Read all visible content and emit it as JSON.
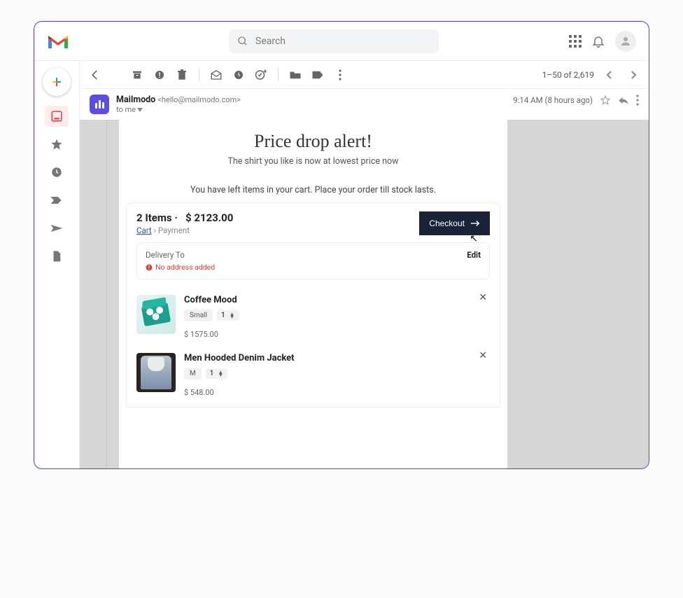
{
  "search": {
    "placeholder": "Search"
  },
  "pager": {
    "range": "1–50 of 2,619"
  },
  "message": {
    "sender_name": "Mailmodo",
    "sender_email": "<hello@mailmodo.com>",
    "to_line": "to me",
    "time": "9:14 AM (8 hours ago)"
  },
  "email": {
    "heading": "Price drop alert!",
    "subheading": "The shirt you like is now at lowest price now",
    "note": "You have left items in your cart. Place your order till stock lasts.",
    "cart": {
      "summary_count": "2 Items ·",
      "summary_total": "$ 2123.00",
      "crumb_cart": "Cart",
      "crumb_sep": " › ",
      "crumb_next": "Payment",
      "checkout_label": "Checkout",
      "delivery": {
        "label": "Delivery To",
        "warn": "No address added",
        "edit": "Edit"
      },
      "items": [
        {
          "title": "Coffee Mood",
          "variant": "Small",
          "qty": "1",
          "price": "$ 1575.00"
        },
        {
          "title": "Men Hooded Denim Jacket",
          "variant": "M",
          "qty": "1",
          "price": "$ 548.00"
        }
      ]
    }
  }
}
